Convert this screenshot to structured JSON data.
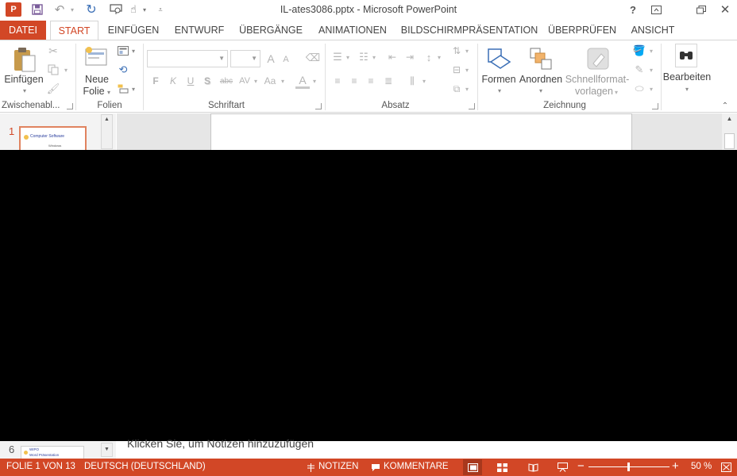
{
  "app": {
    "logo_letter": "P",
    "window_title": "IL-ates3086.pptx - Microsoft PowerPoint"
  },
  "quick_access": {
    "save_icon": "save-icon",
    "undo_icon": "undo-icon",
    "redo_icon": "repeat-icon",
    "start_from_beginning_icon": "slideshow-icon",
    "touch_mode_icon": "touch-mode-icon",
    "customize_icon": "customize-icon"
  },
  "window_buttons": {
    "help": "?",
    "ribbon_options_icon": "ribbon-display-icon",
    "restore_icon": "restore-icon",
    "close": "✕"
  },
  "tabs": [
    "DATEI",
    "START",
    "EINFÜGEN",
    "ENTWURF",
    "ÜBERGÄNGE",
    "ANIMATIONEN",
    "BILDSCHIRMPRÄSENTATION",
    "ÜBERPRÜFEN",
    "ANSICHT"
  ],
  "active_tab": "START",
  "ribbon": {
    "clipboard": {
      "paste_label": "Einfügen",
      "group_label": "Zwischenabl..."
    },
    "slides": {
      "new_slide_line1": "Neue",
      "new_slide_line2": "Folie",
      "group_label": "Folien"
    },
    "font": {
      "font_name_value": "",
      "font_size_value": "",
      "bold": "F",
      "italic": "K",
      "underline": "U",
      "shadow": "S",
      "strikethrough": "abc",
      "spacing": "AV",
      "change_case": "Aa",
      "font_color": "A",
      "grow": "A",
      "shrink": "A",
      "group_label": "Schriftart"
    },
    "paragraph": {
      "group_label": "Absatz"
    },
    "drawing": {
      "shapes_label": "Formen",
      "arrange_label": "Anordnen",
      "quick_styles_line1": "Schnellformat-",
      "quick_styles_line2": "vorlagen",
      "group_label": "Zeichnung"
    },
    "editing": {
      "label": "Bearbeiten"
    }
  },
  "slides_panel": {
    "first_number": "1",
    "first_thumb_title": "Computer Software",
    "first_thumb_subtitle": "Windows",
    "last_number": "6",
    "last_thumb_title": "WIPO",
    "last_thumb_subtitle": "Word Präsentation"
  },
  "notes": {
    "placeholder": "Klicken Sie, um Notizen hinzuzufügen"
  },
  "status_bar": {
    "slide_info": "FOLIE 1 VON 13",
    "language": "DEUTSCH (DEUTSCHLAND)",
    "notes_label": "NOTIZEN",
    "comments_label": "KOMMENTARE",
    "zoom_minus": "−",
    "zoom_plus": "+",
    "zoom_level": "50 %",
    "zoom_fraction": 0.5
  },
  "colors": {
    "accent": "#d24726",
    "ribbon_bg": "#ffffff",
    "canvas_bg": "#e6e6e6"
  }
}
